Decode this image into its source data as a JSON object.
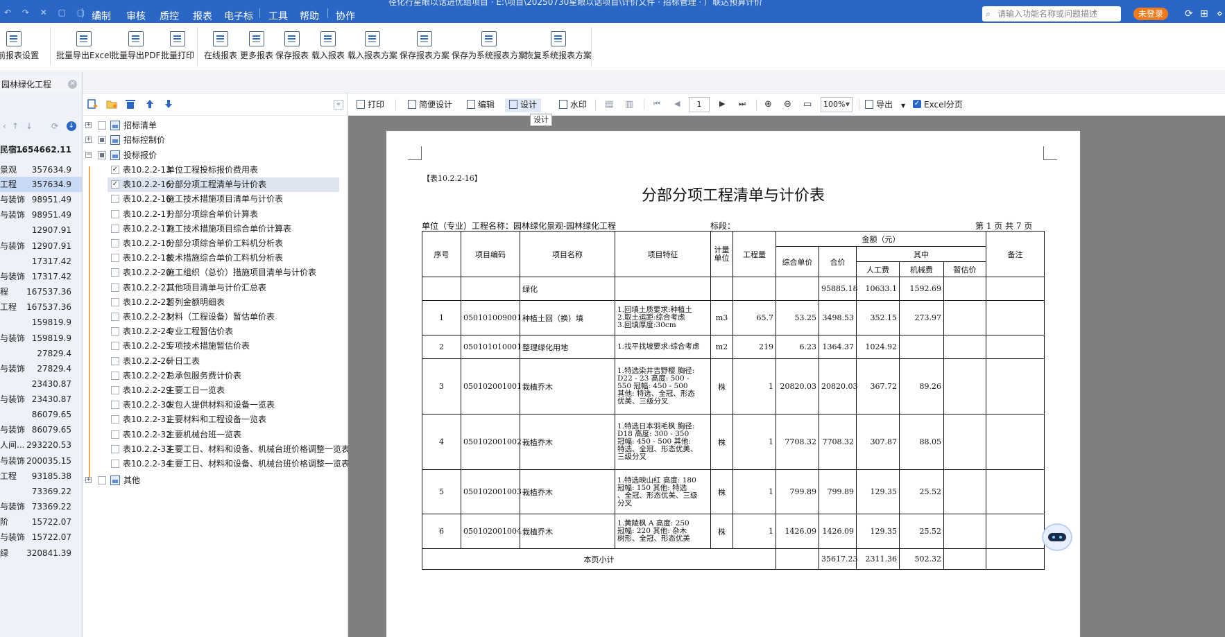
{
  "titlebar": {
    "title": "径化行星眼以话进优组项目 · E:\\项目\\20250730星眼以话项目\\计价文件 · 招标管理 · 广联达预算计价",
    "quick_access": "↶ ↷ ✕ ▢ ▢ ▾",
    "menus": [
      "编制",
      "审核",
      "质控",
      "报表",
      "电子标",
      "工具",
      "帮助",
      "协作"
    ],
    "active_menu": "报表",
    "search_placeholder": "请输入功能名称或问题描述",
    "login_label": "未登录"
  },
  "ribbon": {
    "buttons": [
      "当前报表设置",
      "批量导出Excel",
      "批量导出PDF",
      "批量打印",
      "在线报表",
      "更多报表",
      "保存报表",
      "载入报表",
      "载入报表方案",
      "保存报表方案",
      "保存为系统报表方案",
      "恢复系统报表方案"
    ]
  },
  "left_pane": {
    "project_title": "园林绿化工程",
    "rows": [
      {
        "name": "民宿...",
        "value": "1654662.11",
        "bold": true
      },
      {
        "name": "景观",
        "value": "357634.9"
      },
      {
        "name": "工程",
        "value": "357634.9",
        "selected": true
      },
      {
        "name": "与装饰",
        "value": "98951.49"
      },
      {
        "name": "与装饰",
        "value": "98951.49"
      },
      {
        "name": "",
        "value": "12907.91"
      },
      {
        "name": "与装饰",
        "value": "12907.91"
      },
      {
        "name": "",
        "value": "17317.42"
      },
      {
        "name": "与装饰",
        "value": "17317.42"
      },
      {
        "name": "程",
        "value": "167537.36"
      },
      {
        "name": "工程",
        "value": "167537.36"
      },
      {
        "name": "",
        "value": "159819.9"
      },
      {
        "name": "与装饰",
        "value": "159819.9"
      },
      {
        "name": "",
        "value": "27829.4"
      },
      {
        "name": "与装饰",
        "value": "27829.4"
      },
      {
        "name": "",
        "value": "23430.87"
      },
      {
        "name": "与装饰",
        "value": "23430.87"
      },
      {
        "name": "",
        "value": "86079.65"
      },
      {
        "name": "与装饰",
        "value": "86079.65"
      },
      {
        "name": "人间...",
        "value": "293220.53"
      },
      {
        "name": "与装饰",
        "value": "200035.15"
      },
      {
        "name": "工程",
        "value": "93185.38"
      },
      {
        "name": "",
        "value": "73369.22"
      },
      {
        "name": "与装饰",
        "value": "73369.22"
      },
      {
        "name": "阶",
        "value": "15722.07"
      },
      {
        "name": "与装饰",
        "value": "15722.07"
      },
      {
        "name": "绿",
        "value": "320841.39"
      }
    ]
  },
  "report_tree": {
    "top_nodes": [
      "招标清单",
      "招标控制价",
      "投标报价",
      "其他"
    ],
    "items": [
      {
        "code": "表10.2.2-13",
        "name": "单位工程投标报价费用表",
        "checked": true
      },
      {
        "code": "表10.2.2-16",
        "name": "分部分项工程清单与计价表",
        "checked": true,
        "selected": true
      },
      {
        "code": "表10.2.2-16",
        "name": "施工技术措施项目清单与计价表"
      },
      {
        "code": "表10.2.2-17",
        "name": "分部分项综合单价计算表"
      },
      {
        "code": "表10.2.2-17",
        "name": "施工技术措施项目综合单价计算表"
      },
      {
        "code": "表10.2.2-18",
        "name": "分部分项综合单价工料机分析表"
      },
      {
        "code": "表10.2.2-18",
        "name": "技术措施综合单价工料机分析表"
      },
      {
        "code": "表10.2.2-20",
        "name": "施工组织（总价）措施项目清单与计价表"
      },
      {
        "code": "表10.2.2-21",
        "name": "其他项目清单与计价汇总表"
      },
      {
        "code": "表10.2.2-22",
        "name": "暂列金额明细表"
      },
      {
        "code": "表10.2.2-23",
        "name": "材料（工程设备）暂估单价表"
      },
      {
        "code": "表10.2.2-24",
        "name": "专业工程暂估价表"
      },
      {
        "code": "表10.2.2-25",
        "name": "专项技术措施暂估价表"
      },
      {
        "code": "表10.2.2-26",
        "name": "计日工表"
      },
      {
        "code": "表10.2.2-27",
        "name": "总承包服务费计价表"
      },
      {
        "code": "表10.2.2-29",
        "name": "主要工日一览表"
      },
      {
        "code": "表10.2.2-30",
        "name": "发包人提供材料和设备一览表"
      },
      {
        "code": "表10.2.2-31",
        "name": "主要材料和工程设备一览表"
      },
      {
        "code": "表10.2.2-32",
        "name": "主要机械台班一览表"
      },
      {
        "code": "表10.2.2-33",
        "name": "主要工日、材料和设备、机械台班价格调整一览表"
      },
      {
        "code": "表10.2.2-34",
        "name": "主要工日、材料和设备、机械台班价格调整一览表"
      }
    ]
  },
  "viewer_toolbar": {
    "print": "打印",
    "simple_design": "简便设计",
    "edit": "编辑",
    "design": "设计",
    "watermark": "水印",
    "page": "1",
    "zoom": "100%",
    "export": "导出",
    "excel_paging": "Excel分页",
    "tooltip": "设计"
  },
  "report": {
    "tag": "【表10.2.2-16】",
    "title": "分部分项工程清单与计价表",
    "unit_label": "单位（专业）工程名称：园林绿化景观-园林绿化工程",
    "section_label": "标段：",
    "page_info": "第 1 页  共 7 页",
    "headers": {
      "seq": "序号",
      "code": "项目编码",
      "name": "项目名称",
      "feature": "项目特征",
      "unit": "计量单位",
      "qty": "工程量",
      "amount": "金额（元）",
      "unit_price": "综合单价",
      "total": "合价",
      "of_which": "其中",
      "labor": "人工费",
      "machine": "机械费",
      "provisional": "暂估价",
      "remark": "备注"
    },
    "group_row": {
      "name": "绿化",
      "total": "95885.18",
      "labor": "10633.1",
      "machine": "1592.69"
    },
    "rows": [
      {
        "seq": "1",
        "code": "050101009001",
        "name": "种植土回（换）填",
        "feature": "1.回填土质要求:种植土\n2.取土运距:综合考虑\n3.回填厚度:30cm",
        "unit": "m3",
        "qty": "65.7",
        "unit_price": "53.25",
        "total": "3498.53",
        "labor": "352.15",
        "machine": "273.97"
      },
      {
        "seq": "2",
        "code": "050101010001",
        "name": "整理绿化用地",
        "feature": "1.找平找坡要求:综合考虑",
        "unit": "m2",
        "qty": "219",
        "unit_price": "6.23",
        "total": "1364.37",
        "labor": "1024.92",
        "machine": ""
      },
      {
        "seq": "3",
        "code": "050102001001",
        "name": "栽植乔木",
        "feature": "1.特选染井吉野樱 胸径:\nD22 - 23 高度: 500 -\n550 冠幅: 450 - 500\n其他: 特选、全冠、形态\n优美、三级分叉",
        "unit": "株",
        "qty": "1",
        "unit_price": "20820.03",
        "total": "20820.03",
        "labor": "367.72",
        "machine": "89.26"
      },
      {
        "seq": "4",
        "code": "050102001002",
        "name": "栽植乔木",
        "feature": "1.特选日本羽毛枫 胸径:\nD18 高度: 300 - 350\n冠幅: 450 - 500 其他:\n特选、全冠、形态优美、\n三级分叉",
        "unit": "株",
        "qty": "1",
        "unit_price": "7708.32",
        "total": "7708.32",
        "labor": "307.87",
        "machine": "88.05"
      },
      {
        "seq": "5",
        "code": "050102001003",
        "name": "栽植乔木",
        "feature": "1.特选映山红 高度: 180\n冠幅: 150 其他: 特选\n、全冠、形态优美、三级\n分叉",
        "unit": "株",
        "qty": "1",
        "unit_price": "799.89",
        "total": "799.89",
        "labor": "129.35",
        "machine": "25.52"
      },
      {
        "seq": "6",
        "code": "050102001004",
        "name": "栽植乔木",
        "feature": "1.黄陵枫 A 高度: 250\n冠幅: 220 其他: 杂木\n树形、全冠、形态优美",
        "unit": "株",
        "qty": "1",
        "unit_price": "1426.09",
        "total": "1426.09",
        "labor": "129.35",
        "machine": "25.52"
      }
    ],
    "subtotal": {
      "label": "本页小计",
      "total": "35617.23",
      "labor": "2311.36",
      "machine": "502.32"
    }
  }
}
